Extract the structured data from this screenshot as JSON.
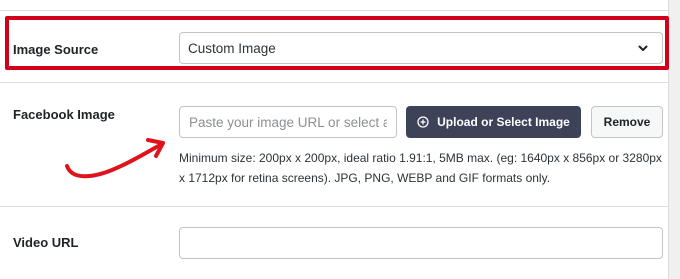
{
  "image_source": {
    "label": "Image Source",
    "selected": "Custom Image"
  },
  "facebook_image": {
    "label": "Facebook Image",
    "placeholder": "Paste your image URL or select a r",
    "upload_label": "Upload or Select Image",
    "remove_label": "Remove",
    "help_text": "Minimum size: 200px x 200px, ideal ratio 1.91:1, 5MB max. (eg: 1640px x 856px or 3280px x 1712px for retina screens). JPG, PNG, WEBP and GIF formats only."
  },
  "video_url": {
    "label": "Video URL",
    "value": ""
  },
  "colors": {
    "highlight": "#d0021b",
    "arrow": "#e0121b",
    "primary_button": "#3c4358"
  },
  "icons": {
    "select_caret": "chevron-down-icon",
    "upload": "plus-circle-icon",
    "annotation": "red-curved-arrow"
  }
}
